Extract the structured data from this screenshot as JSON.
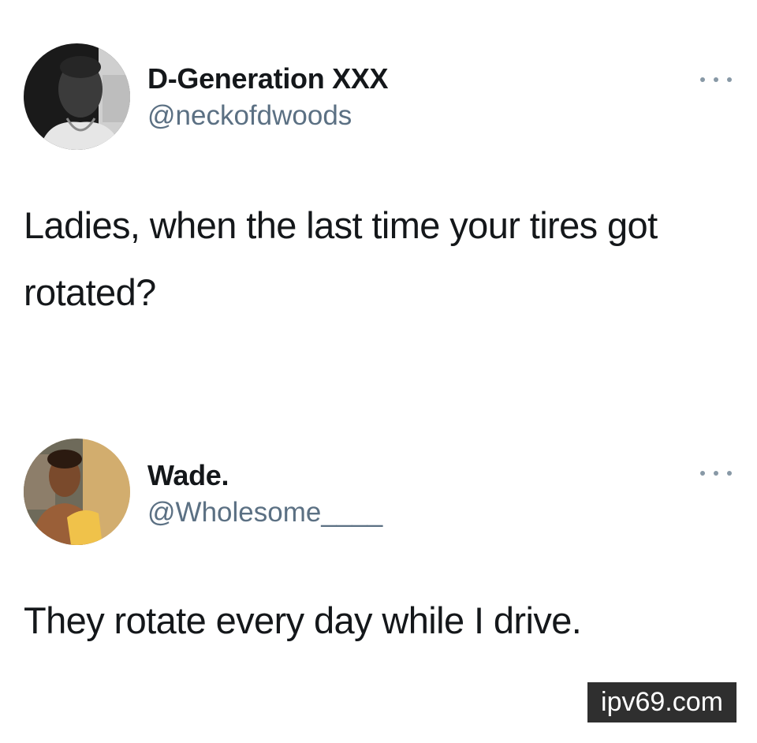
{
  "tweets": [
    {
      "display_name": "D-Generation XXX",
      "handle": "@neckofdwoods",
      "text": "Ladies, when the last time your tires got rotated?",
      "more_icon": "more-horizontal-icon"
    },
    {
      "display_name": "Wade.",
      "handle": "@Wholesome____",
      "text": "They rotate every day while I drive.",
      "more_icon": "more-horizontal-icon"
    }
  ],
  "watermark": {
    "text": "ipv69.com"
  },
  "colors": {
    "name": "#14171a",
    "handle": "#5b7083",
    "dots": "#8899a6",
    "watermark_bg": "#2f2f2f"
  }
}
